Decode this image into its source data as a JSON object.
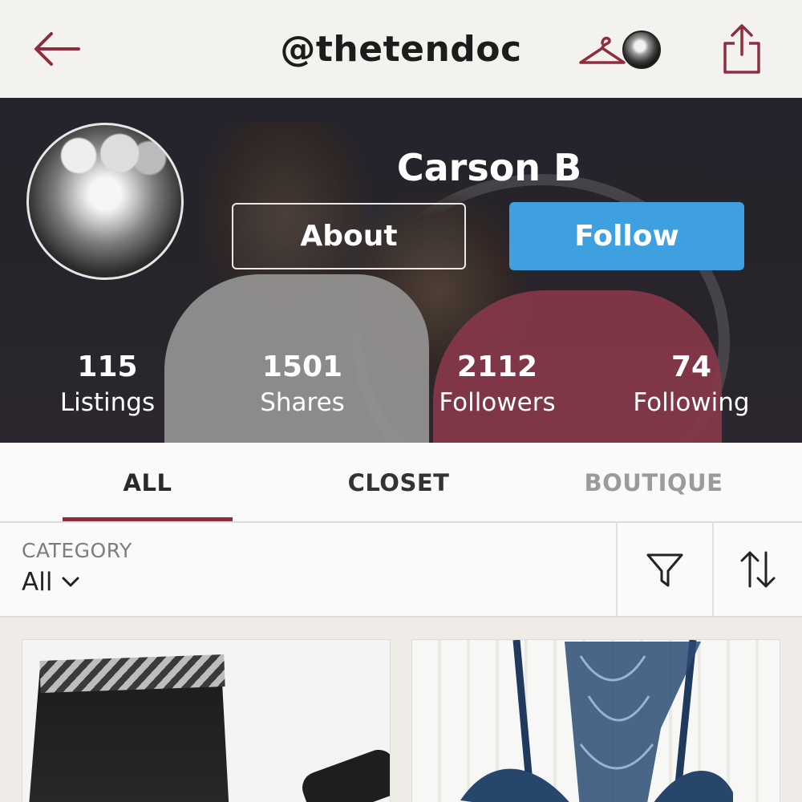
{
  "navbar": {
    "title": "@thetendoc"
  },
  "profile": {
    "name": "Carson B",
    "about_label": "About",
    "follow_label": "Follow"
  },
  "stats": [
    {
      "value": "115",
      "label": "Listings"
    },
    {
      "value": "1501",
      "label": "Shares"
    },
    {
      "value": "2112",
      "label": "Followers"
    },
    {
      "value": "74",
      "label": "Following"
    }
  ],
  "tabs": [
    {
      "label": "ALL",
      "active": true
    },
    {
      "label": "CLOSET",
      "active": false
    },
    {
      "label": "BOUTIQUE",
      "active": false
    }
  ],
  "filters": {
    "category_label": "CATEGORY",
    "category_value": "All"
  },
  "colors": {
    "accent": "#8e2d3d",
    "follow_button": "#3fa0df",
    "inactive_tab": "#9b9b9b"
  },
  "icons": {
    "back": "arrow-left-icon",
    "hanger": "hanger-icon",
    "share": "share-icon",
    "filter": "funnel-icon",
    "sort": "sort-arrows-icon",
    "dropdown": "chevron-down-icon"
  }
}
